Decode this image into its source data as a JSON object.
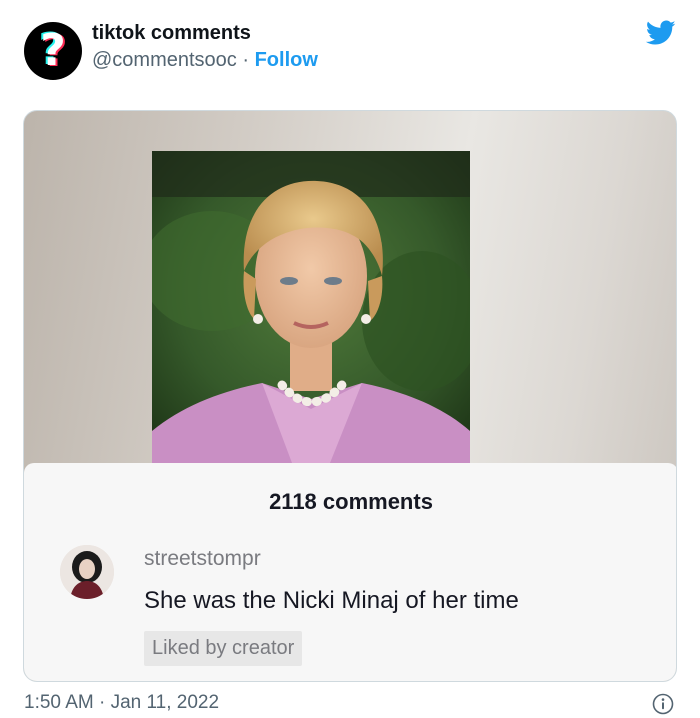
{
  "account": {
    "display_name": "tiktok comments",
    "handle": "@commentsooc",
    "separator": " · ",
    "follow_label": "Follow",
    "avatar_icon": "question-mark-icon"
  },
  "brand_icon": "twitter-bird-icon",
  "colors": {
    "accent": "#1d9bf0",
    "text": "#0f1419",
    "muted": "#536471",
    "tiktok_cyan": "#25f4ee",
    "tiktok_red": "#fe2c55"
  },
  "media": {
    "comments_count": "2118 comments",
    "comment": {
      "username": "streetstompr",
      "text": "She was the Nicki Minaj of her time",
      "badge": "Liked by creator"
    }
  },
  "meta": {
    "timestamp": "1:50 AM · Jan 11, 2022",
    "info_icon": "info-icon"
  }
}
